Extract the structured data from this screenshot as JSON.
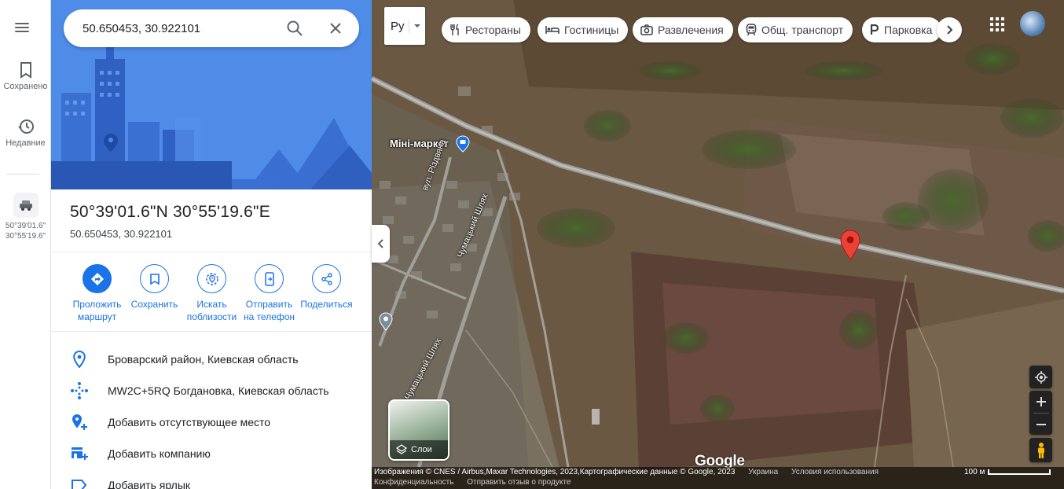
{
  "rail": {
    "saved_label": "Сохранено",
    "recent_label": "Недавние",
    "recent_item": {
      "line1": "50°39'01.6\"",
      "line2": "30°55'19.6\""
    }
  },
  "search": {
    "value": "50.650453, 30.922101"
  },
  "place": {
    "title": "50°39'01.6\"N 30°55'19.6\"E",
    "subtitle": "50.650453, 30.922101"
  },
  "actions": [
    {
      "label": "Проложить маршрут",
      "icon": "directions-icon"
    },
    {
      "label": "Сохранить",
      "icon": "bookmark-icon"
    },
    {
      "label": "Искать поблизости",
      "icon": "nearby-icon"
    },
    {
      "label": "Отправить на телефон",
      "icon": "send-to-phone-icon"
    },
    {
      "label": "Поделиться",
      "icon": "share-icon"
    }
  ],
  "info": [
    {
      "text": "Броварский район, Киевская область",
      "icon": "location-pin-icon"
    },
    {
      "text": "MW2C+5RQ Богдановка, Киевская область",
      "icon": "plus-code-icon"
    },
    {
      "text": "Добавить отсутствующее место",
      "icon": "add-place-icon"
    },
    {
      "text": "Добавить компанию",
      "icon": "add-business-icon"
    },
    {
      "text": "Добавить ярлык",
      "icon": "label-icon"
    }
  ],
  "map": {
    "language": "Ру",
    "chips": [
      {
        "label": "Рестораны",
        "icon": "restaurant-icon"
      },
      {
        "label": "Гостиницы",
        "icon": "hotel-icon"
      },
      {
        "label": "Развлечения",
        "icon": "camera-icon"
      },
      {
        "label": "Общ. транспорт",
        "icon": "transit-icon"
      },
      {
        "label": "Парковка",
        "icon": "parking-icon"
      }
    ],
    "poi_labels": {
      "mini_market": "Міні-маркет",
      "street1": "вул. Різдвяна",
      "street2": "Чумацький Шлях",
      "street3": "Чумацький Шлях"
    },
    "layers_label": "Слои",
    "logo": "Google",
    "footer": {
      "imagery": "Изображения © CNES / Airbus,Maxar Technologies, 2023,Картографические данные © Google, 2023",
      "country": "Украина",
      "terms": "Условия использования",
      "privacy": "Конфиденциальность",
      "feedback": "Отправить отзыв о продукте",
      "scale": "100 м"
    }
  }
}
